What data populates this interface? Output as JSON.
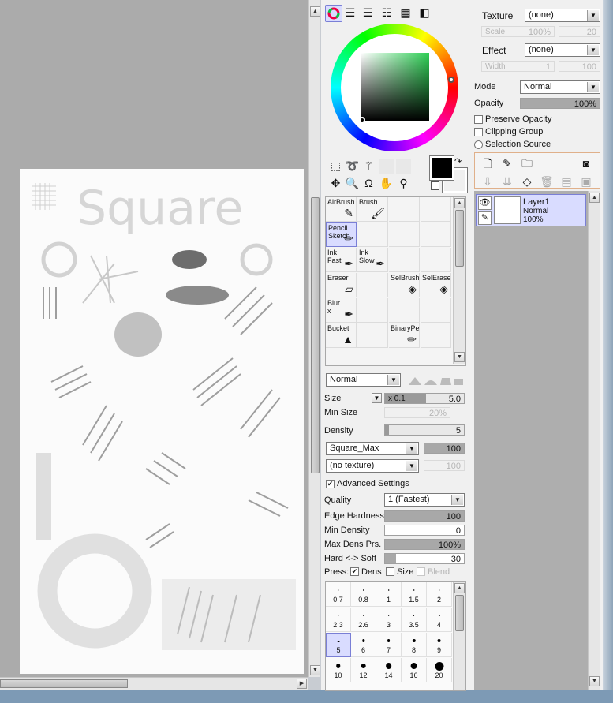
{
  "canvas": {
    "doodle_text": "Square"
  },
  "view_tabs": [
    "color-wheel-icon",
    "rgb-sliders-icon",
    "hsv-sliders-icon",
    "color-swatch-icon",
    "grid-icon",
    "scratchpad-icon"
  ],
  "colors": {
    "primary": "#000000",
    "secondary": "#000000",
    "accent_hover": "#d9dcff"
  },
  "tools": [
    "select-rect-icon",
    "lasso-icon",
    "magic-wand-icon",
    "move-icon",
    "zoom-icon",
    "rotate-icon",
    "hand-icon",
    "eyedropper-icon"
  ],
  "brush_grid": [
    {
      "label": "AirBrush",
      "icon": "✎"
    },
    {
      "label": "Brush",
      "icon": "🖌"
    },
    {
      "label": "Pencil\nSketch",
      "icon": "✏",
      "selected": true
    },
    {
      "label": "Ink\nFast",
      "icon": "✒"
    },
    {
      "label": "Ink\nSlow",
      "icon": "✒"
    },
    {
      "label": "Eraser",
      "icon": "▱"
    },
    {
      "label": "SelBrush",
      "icon": "◈"
    },
    {
      "label": "SelErase",
      "icon": "◈"
    },
    {
      "label": "Blur\nx",
      "icon": "✒"
    },
    {
      "label": "Bucket",
      "icon": "▲"
    },
    {
      "label": "BinaryPe",
      "icon": "✏"
    }
  ],
  "brush_settings": {
    "blend_mode": "Normal",
    "size_label": "Size",
    "size_mult": "x 0.1",
    "size_value": "5.0",
    "min_size_label": "Min Size",
    "min_size_value": "20%",
    "density_label": "Density",
    "density_value": "5",
    "shape": "Square_Max",
    "shape_value": "100",
    "texture": "(no texture)",
    "texture_value": "100",
    "advanced_label": "Advanced Settings",
    "quality_label": "Quality",
    "quality_value": "1 (Fastest)",
    "edge_hardness_label": "Edge Hardness",
    "edge_hardness_value": "100",
    "min_density_label": "Min Density",
    "min_density_value": "0",
    "max_dens_label": "Max Dens Prs.",
    "max_dens_value": "100%",
    "hard_soft_label": "Hard <-> Soft",
    "hard_soft_value": "30",
    "press_label": "Press:",
    "press_dens": "Dens",
    "press_size": "Size",
    "press_blend": "Blend"
  },
  "brush_sizes": [
    "0.7",
    "0.8",
    "1",
    "1.5",
    "2",
    "2.3",
    "2.6",
    "3",
    "3.5",
    "4",
    "5",
    "6",
    "7",
    "8",
    "9",
    "10",
    "12",
    "14",
    "16",
    "20"
  ],
  "right_panel": {
    "texture_label": "Texture",
    "texture_value": "(none)",
    "scale_label": "Scale",
    "scale_value": "100%",
    "scale_num": "20",
    "effect_label": "Effect",
    "effect_value": "(none)",
    "width_label": "Width",
    "width_num": "1",
    "width_value": "100",
    "mode_label": "Mode",
    "mode_value": "Normal",
    "opacity_label": "Opacity",
    "opacity_value": "100%",
    "preserve_opacity": "Preserve Opacity",
    "clipping_group": "Clipping Group",
    "selection_source": "Selection Source"
  },
  "layer": {
    "name": "Layer1",
    "mode": "Normal",
    "opacity": "100%"
  }
}
